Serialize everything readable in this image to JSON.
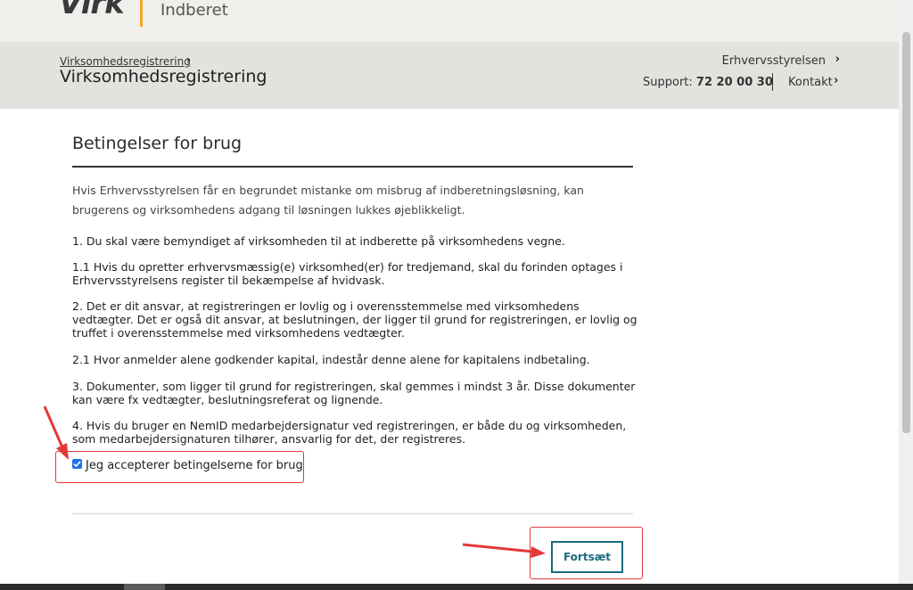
{
  "brand": {
    "logo": "Virk",
    "product": "Indberet",
    "accent": "#f5a623"
  },
  "header": {
    "breadcrumb": "Virksomhedsregistrering",
    "title": "Virksomhedsregistrering",
    "organization": "Erhvervsstyrelsen",
    "support_label": "Support:",
    "support_number": "72 20 00 30",
    "contact": "Kontakt"
  },
  "main": {
    "section_title": "Betingelser for brug",
    "intro": "Hvis Erhvervsstyrelsen får en begrundet mistanke om misbrug af indberetningsløsning, kan brugerens og virksomhedens adgang til løsningen lukkes øjeblikkeligt.",
    "clauses": [
      "1. Du skal være bemyndiget af virksomheden til at indberette på virksomhedens vegne.",
      "1.1 Hvis du opretter erhvervsmæssig(e) virksomhed(er) for tredjemand, skal du forinden optages i Erhvervsstyrelsens register til bekæmpelse af hvidvask.",
      "2. Det er dit ansvar, at registreringen er lovlig og i overensstemmelse med virksomhedens vedtægter. Det er også dit ansvar, at beslutningen, der ligger til grund for registreringen, er lovlig og truffet i overensstemmelse med virksomhedens vedtægter.",
      "2.1 Hvor anmelder alene godkender kapital, indestår denne alene for kapitalens indbetaling.",
      "3. Dokumenter, som ligger til grund for registreringen, skal gemmes i mindst 3 år. Disse dokumenter kan være fx vedtægter, beslutningsreferat og lignende.",
      "4. Hvis du bruger en NemID medarbejdersignatur ved registreringen, er både du og virksomheden, som medarbejdersignaturen tilhører, ansvarlig for det, der registreres."
    ],
    "accept_label": "Jeg accepterer betingelserne for brug",
    "accept_checked": true,
    "continue_button": "Fortsæt"
  },
  "annotation_color": "#e23a3a",
  "button_color": "#1b6b7e"
}
